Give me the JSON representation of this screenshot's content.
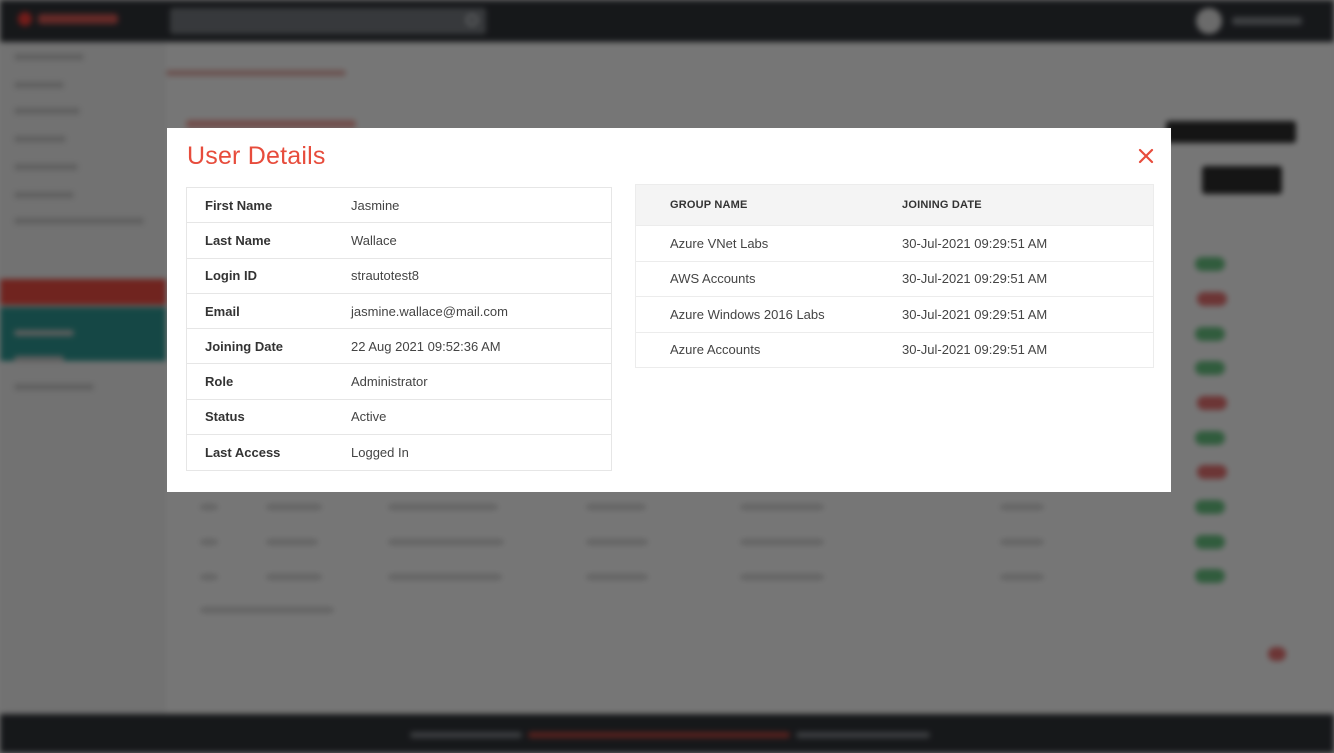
{
  "modal": {
    "title": "User Details",
    "close_icon": "close-icon"
  },
  "user_info": [
    {
      "label": "First Name",
      "value": "Jasmine"
    },
    {
      "label": "Last Name",
      "value": "Wallace"
    },
    {
      "label": "Login ID",
      "value": "strautotest8"
    },
    {
      "label": "Email",
      "value": "jasmine.wallace@mail.com"
    },
    {
      "label": "Joining Date",
      "value": "22 Aug 2021 09:52:36 AM"
    },
    {
      "label": "Role",
      "value": "Administrator"
    },
    {
      "label": "Status",
      "value": "Active"
    },
    {
      "label": "Last Access",
      "value": "Logged In"
    }
  ],
  "groups": {
    "headers": [
      "GROUP NAME",
      "JOINING DATE"
    ],
    "rows": [
      {
        "name": "Azure VNet Labs",
        "date": "30-Jul-2021 09:29:51 AM"
      },
      {
        "name": "AWS Accounts",
        "date": "30-Jul-2021 09:29:51 AM"
      },
      {
        "name": "Azure Windows 2016 Labs",
        "date": "30-Jul-2021 09:29:51 AM"
      },
      {
        "name": "Azure Accounts",
        "date": "30-Jul-2021 09:29:51 AM"
      }
    ]
  },
  "colors": {
    "accent": "#e74c3c",
    "overlay": "rgba(0,0,0,0.5)",
    "topbar": "#2d3035"
  }
}
